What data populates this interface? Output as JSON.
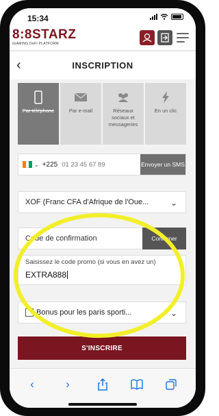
{
  "status_bar": {
    "time": "15:34"
  },
  "header": {
    "logo_text": "8:8STARZ",
    "logo_subtitle": "iGAMING DeFi PLATFORM"
  },
  "page": {
    "title": "INSCRIPTION"
  },
  "tabs": [
    {
      "label": "Par téléphone",
      "icon": "phone-icon",
      "active": true
    },
    {
      "label": "Par e-mail",
      "icon": "envelope-icon",
      "active": false
    },
    {
      "label": "Réseaux sociaux et messageries",
      "icon": "users-icon",
      "active": false
    },
    {
      "label": "En un clic",
      "icon": "lightning-icon",
      "active": false
    }
  ],
  "phone": {
    "dial_code": "+225",
    "placeholder": "01 23 45 67 89",
    "sms_button": "Envoyer un SMS"
  },
  "currency": {
    "value": "XOF (Franc CFA d'Afrique de l'Oue..."
  },
  "confirmation": {
    "label": "Code de confirmation",
    "button": "Confirmer"
  },
  "promo": {
    "label": "Saisissez le code promo (si vous en avez un)",
    "value": "EXTRA888"
  },
  "bonus": {
    "value": "Bonus pour les paris sporti..."
  },
  "register": {
    "label": "S'INSCRIRE"
  },
  "colors": {
    "brand": "#7a1620",
    "highlight": "#f2ef2a",
    "browser_accent": "#1a73e8"
  }
}
